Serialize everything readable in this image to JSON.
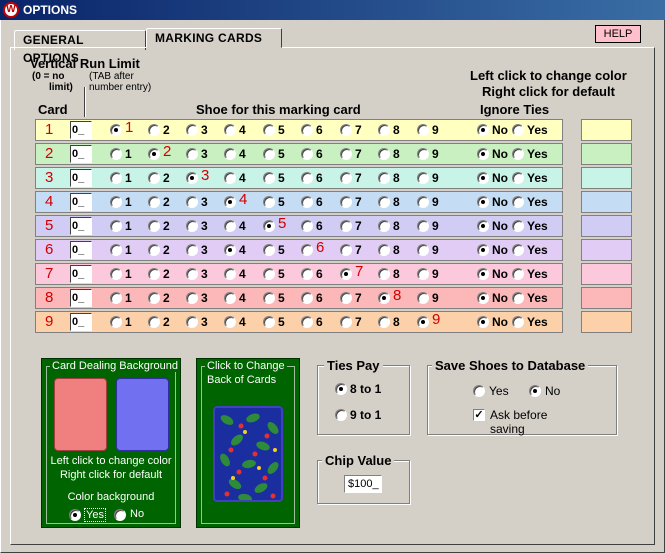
{
  "window": {
    "title": "OPTIONS",
    "logo": "W"
  },
  "tabs": [
    {
      "label": "GENERAL OPTIONS"
    },
    {
      "label": "MARKING CARDS"
    }
  ],
  "help_label": "HELP",
  "header": {
    "vertical_run_limit": "Vertical Run Limit",
    "zero_no_1": "(0 = no",
    "zero_no_2": "limit)",
    "tab_after_1": "(TAB after",
    "tab_after_2": "number entry)",
    "card": "Card",
    "shoe": "Shoe for this marking card",
    "ignore_ties": "Ignore Ties",
    "color_hint_1": "Left click to change color",
    "color_hint_2": "Right click for default"
  },
  "rows": [
    {
      "card": "1",
      "limit": "0_",
      "selected_shoe": 1,
      "ignore_ties": "No",
      "color": "#ffffc0"
    },
    {
      "card": "2",
      "limit": "0_",
      "selected_shoe": 2,
      "ignore_ties": "No",
      "color": "#c8f0c0"
    },
    {
      "card": "3",
      "limit": "0_",
      "selected_shoe": 3,
      "ignore_ties": "No",
      "color": "#c8f4e8"
    },
    {
      "card": "4",
      "limit": "0_",
      "selected_shoe": 4,
      "ignore_ties": "No",
      "color": "#c4dcf4"
    },
    {
      "card": "5",
      "limit": "0_",
      "selected_shoe": 5,
      "ignore_ties": "No",
      "color": "#d0ccf4"
    },
    {
      "card": "6",
      "limit": "0_",
      "selected_shoe": 4,
      "ignore_ties": "No",
      "color": "#e0ccf4"
    },
    {
      "card": "7",
      "limit": "0_",
      "selected_shoe": 7,
      "ignore_ties": "No",
      "color": "#fcc8dc"
    },
    {
      "card": "8",
      "limit": "0_",
      "selected_shoe": 8,
      "ignore_ties": "No",
      "color": "#fcb8b8"
    },
    {
      "card": "9",
      "limit": "0_",
      "selected_shoe": 9,
      "ignore_ties": "No",
      "color": "#fcd0a8"
    }
  ],
  "shoe_numbers": [
    "1",
    "2",
    "3",
    "4",
    "5",
    "6",
    "7",
    "8",
    "9"
  ],
  "ignore_options": [
    "No",
    "Yes"
  ],
  "card_bg": {
    "title": "Card Dealing Background",
    "hint_1": "Left click to change color",
    "hint_2": "Right click for default",
    "color_bg_label": "Color background",
    "options": [
      "Yes",
      "No"
    ],
    "selected": "Yes",
    "color_left": "#f08080",
    "color_right": "#7070f0"
  },
  "card_back": {
    "title_1": "Click to Change",
    "title_2": "Back of Cards"
  },
  "ties_pay": {
    "title": "Ties Pay",
    "options": [
      "8 to 1",
      "9 to 1"
    ],
    "selected": "8 to 1"
  },
  "save_shoes": {
    "title": "Save Shoes to Database",
    "options": [
      "Yes",
      "No"
    ],
    "selected": "No",
    "ask_label": "Ask before saving",
    "ask_checked": true
  },
  "chip_value": {
    "title": "Chip Value",
    "value": "$100_"
  }
}
